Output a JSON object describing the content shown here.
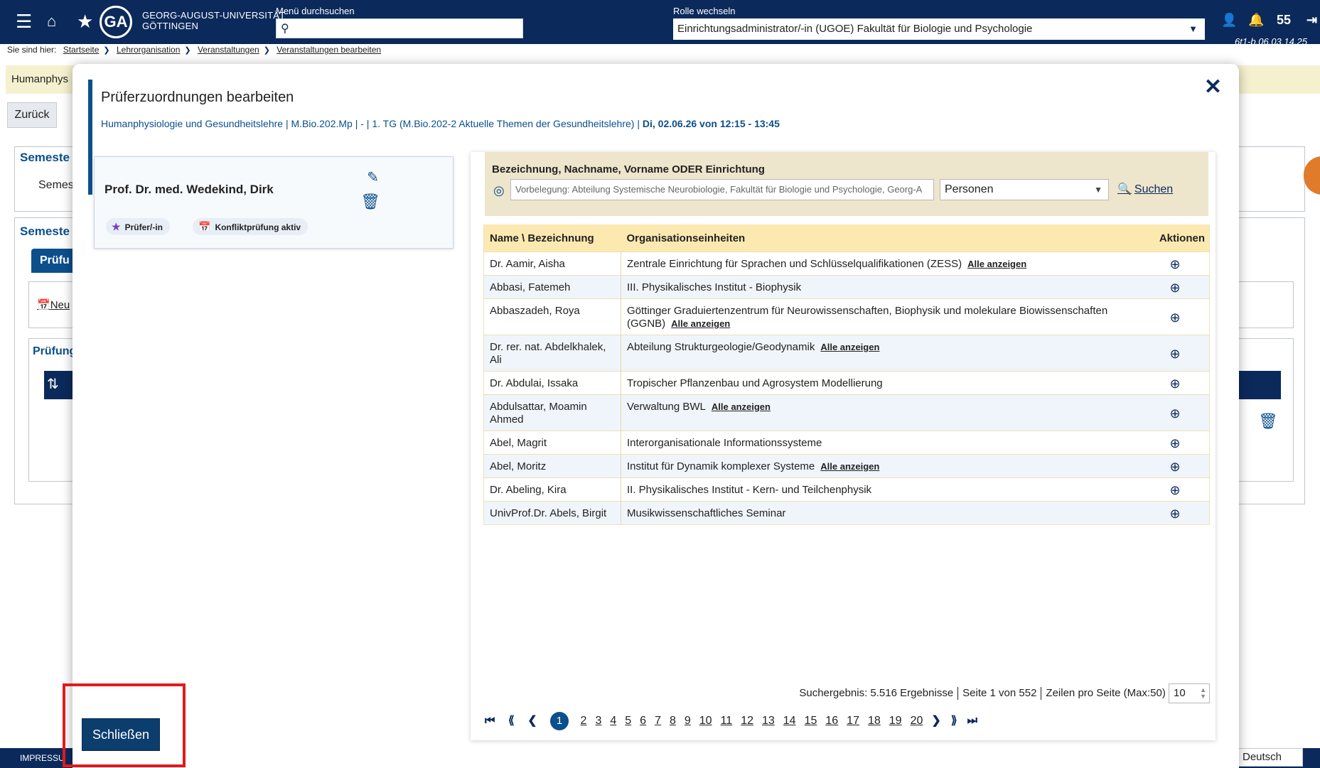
{
  "topbar": {
    "university_line1": "GEORG-AUGUST-UNIVERSITÄT",
    "university_line2": "GÖTTINGEN",
    "logo_letters": "GA",
    "menu_search_label": "Menü durchsuchen",
    "menu_search_placeholder": "",
    "role_label": "Rolle wechseln",
    "role_value": "Einrichtungsadministrator/-in (UGOE) Fakultät für Biologie und Psychologie",
    "notification_count": "55",
    "version": "6t1-b.06.03.14.25"
  },
  "breadcrumb": {
    "label": "Sie sind hier:",
    "items": [
      "Startseite",
      "Lehrorganisation",
      "Veranstaltungen",
      "Veranstaltungen bearbeiten"
    ]
  },
  "background": {
    "yellow_text": "Humanphys",
    "back_button": "Zurück",
    "semester_head_1": "Semeste",
    "semester_text_1": "Semes",
    "semester_head_2": "Semeste",
    "tab_label": "Prüfu",
    "new_link": "Neu",
    "pruefung_head": "Prüfung",
    "footer_impressum": "IMPRESSU",
    "language": "Deutsch"
  },
  "modal": {
    "title": "Prüferzuordnungen bearbeiten",
    "subtitle_plain": "Humanphysiologie und Gesundheitslehre | M.Bio.202.Mp | - | 1. TG (M.Bio.202-2 Aktuelle Themen der Gesundheitslehre) |",
    "subtitle_bold": "Di, 02.06.26 von 12:15 - 13:45",
    "close_button": "Schließen"
  },
  "examiner": {
    "name": "Prof. Dr. med. Wedekind, Dirk",
    "tag_role": "Prüfer/-in",
    "tag_conflict": "Konfliktprüfung aktiv"
  },
  "search": {
    "label": "Bezeichnung, Nachname, Vorname ODER Einrichtung",
    "input_value": "Vorbelegung: Abteilung Systemische Neurobiologie, Fakultät für Biologie und Psychologie, Georg-A",
    "type_value": "Personen",
    "button": "Suchen"
  },
  "table": {
    "headers": [
      "Name \\ Bezeichnung",
      "Organisationseinheiten",
      "Aktionen"
    ],
    "show_all_label": "Alle anzeigen",
    "rows": [
      {
        "name": "Dr. Aamir, Aisha",
        "org": "Zentrale Einrichtung für Sprachen und Schlüsselqualifikationen (ZESS)",
        "show_all": true
      },
      {
        "name": "Abbasi, Fatemeh",
        "org": "III. Physikalisches Institut - Biophysik",
        "show_all": false
      },
      {
        "name": "Abbaszadeh, Roya",
        "org": "Göttinger Graduiertenzentrum für Neurowissenschaften, Biophysik und molekulare Biowissenschaften (GGNB)",
        "show_all": true
      },
      {
        "name": "Dr. rer. nat. Abdelkhalek, Ali",
        "org": "Abteilung Strukturgeologie/Geodynamik",
        "show_all": true
      },
      {
        "name": "Dr. Abdulai, Issaka",
        "org": "Tropischer Pflanzenbau und Agrosystem Modellierung",
        "show_all": false
      },
      {
        "name": "Abdulsattar, Moamin Ahmed",
        "org": "Verwaltung BWL",
        "show_all": true
      },
      {
        "name": "Abel, Magrit",
        "org": "Interorganisationale Informationssysteme",
        "show_all": false
      },
      {
        "name": "Abel, Moritz",
        "org": "Institut für Dynamik komplexer Systeme",
        "show_all": true
      },
      {
        "name": "Dr. Abeling, Kira",
        "org": "II. Physikalisches Institut - Kern- und Teilchenphysik",
        "show_all": false
      },
      {
        "name": "UnivProf.Dr. Abels, Birgit",
        "org": "Musikwissenschaftliches Seminar",
        "show_all": false
      }
    ]
  },
  "pagination": {
    "result_text": "Suchergebnis: 5.516 Ergebnisse",
    "page_text": "Seite 1 von 552",
    "rows_label": "Zeilen pro Seite (Max:50)",
    "rows_value": "10",
    "current_page": "1",
    "pages": [
      "2",
      "3",
      "4",
      "5",
      "6",
      "7",
      "8",
      "9",
      "10",
      "11",
      "12",
      "13",
      "14",
      "15",
      "16",
      "17",
      "18",
      "19",
      "20"
    ]
  }
}
